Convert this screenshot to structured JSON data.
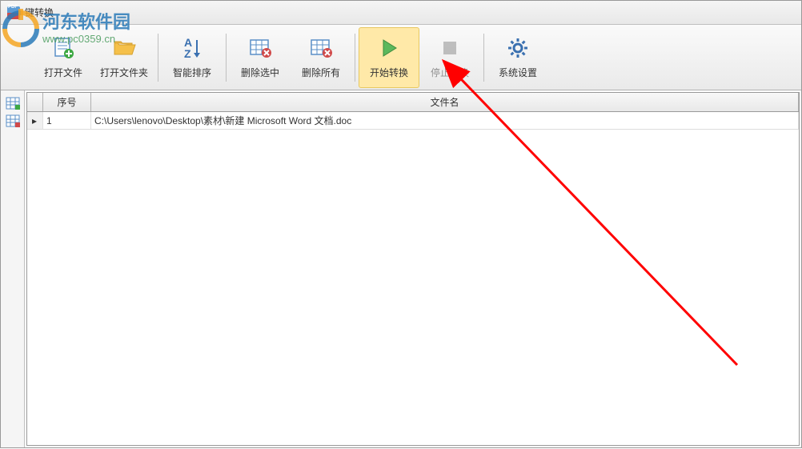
{
  "window": {
    "title": "键转换"
  },
  "watermark": {
    "site_name": "河东软件园",
    "url": "www.pc0359.cn"
  },
  "toolbar": {
    "open_file": "打开文件",
    "open_folder": "打开文件夹",
    "smart_sort": "智能排序",
    "delete_selected": "删除选中",
    "delete_all": "删除所有",
    "start_convert": "开始转换",
    "stop_convert": "停止转换",
    "system_settings": "系统设置"
  },
  "table": {
    "columns": {
      "seq": "序号",
      "filename": "文件名"
    },
    "rows": [
      {
        "marker": "▸",
        "seq": "1",
        "filename": "C:\\Users\\lenovo\\Desktop\\素材\\新建 Microsoft Word 文档.doc"
      }
    ]
  }
}
